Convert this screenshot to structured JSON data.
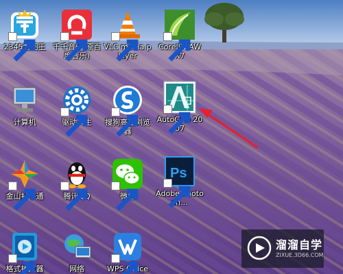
{
  "desktop": {
    "icons": [
      {
        "id": "2345kantu",
        "label": "2345看图王",
        "icon": "image-viewer-icon",
        "shortcut": true
      },
      {
        "id": "qianqian",
        "label": "千千音乐(原百度音乐)",
        "icon": "music-player-icon",
        "shortcut": true
      },
      {
        "id": "vlc",
        "label": "VLC media player",
        "icon": "vlc-cone-icon",
        "shortcut": true
      },
      {
        "id": "coreldraw",
        "label": "CorelDRAW X7",
        "icon": "coreldraw-icon",
        "shortcut": true
      },
      {
        "id": "computer",
        "label": "计算机",
        "icon": "computer-icon",
        "shortcut": false
      },
      {
        "id": "qudongrensheng",
        "label": "驱动人生",
        "icon": "driver-gear-icon",
        "shortcut": true
      },
      {
        "id": "sogou",
        "label": "搜狗高速浏览器",
        "icon": "sogou-browser-icon",
        "shortcut": true
      },
      {
        "id": "autocad",
        "label": "AutoCAD 2007",
        "icon": "autocad-icon",
        "shortcut": true
      },
      {
        "id": "jinshan",
        "label": "金山打字通",
        "icon": "typing-tutor-icon",
        "shortcut": true
      },
      {
        "id": "qq",
        "label": "腾讯QQ",
        "icon": "qq-penguin-icon",
        "shortcut": true
      },
      {
        "id": "wechat",
        "label": "微信",
        "icon": "wechat-icon",
        "shortcut": true
      },
      {
        "id": "photoshop",
        "label": "Adobe Photosh...",
        "icon": "photoshop-icon",
        "shortcut": true
      },
      {
        "id": "geshi",
        "label": "格式播放器",
        "icon": "format-player-icon",
        "shortcut": true
      },
      {
        "id": "network",
        "label": "网络",
        "icon": "network-icon",
        "shortcut": false
      },
      {
        "id": "wps",
        "label": "WPS Office",
        "icon": "wps-office-icon",
        "shortcut": true
      }
    ]
  },
  "watermark": {
    "title": "溜溜自学",
    "url": "ZIXUE.3D66.COM"
  },
  "annotation": {
    "color": "#e8202a"
  }
}
